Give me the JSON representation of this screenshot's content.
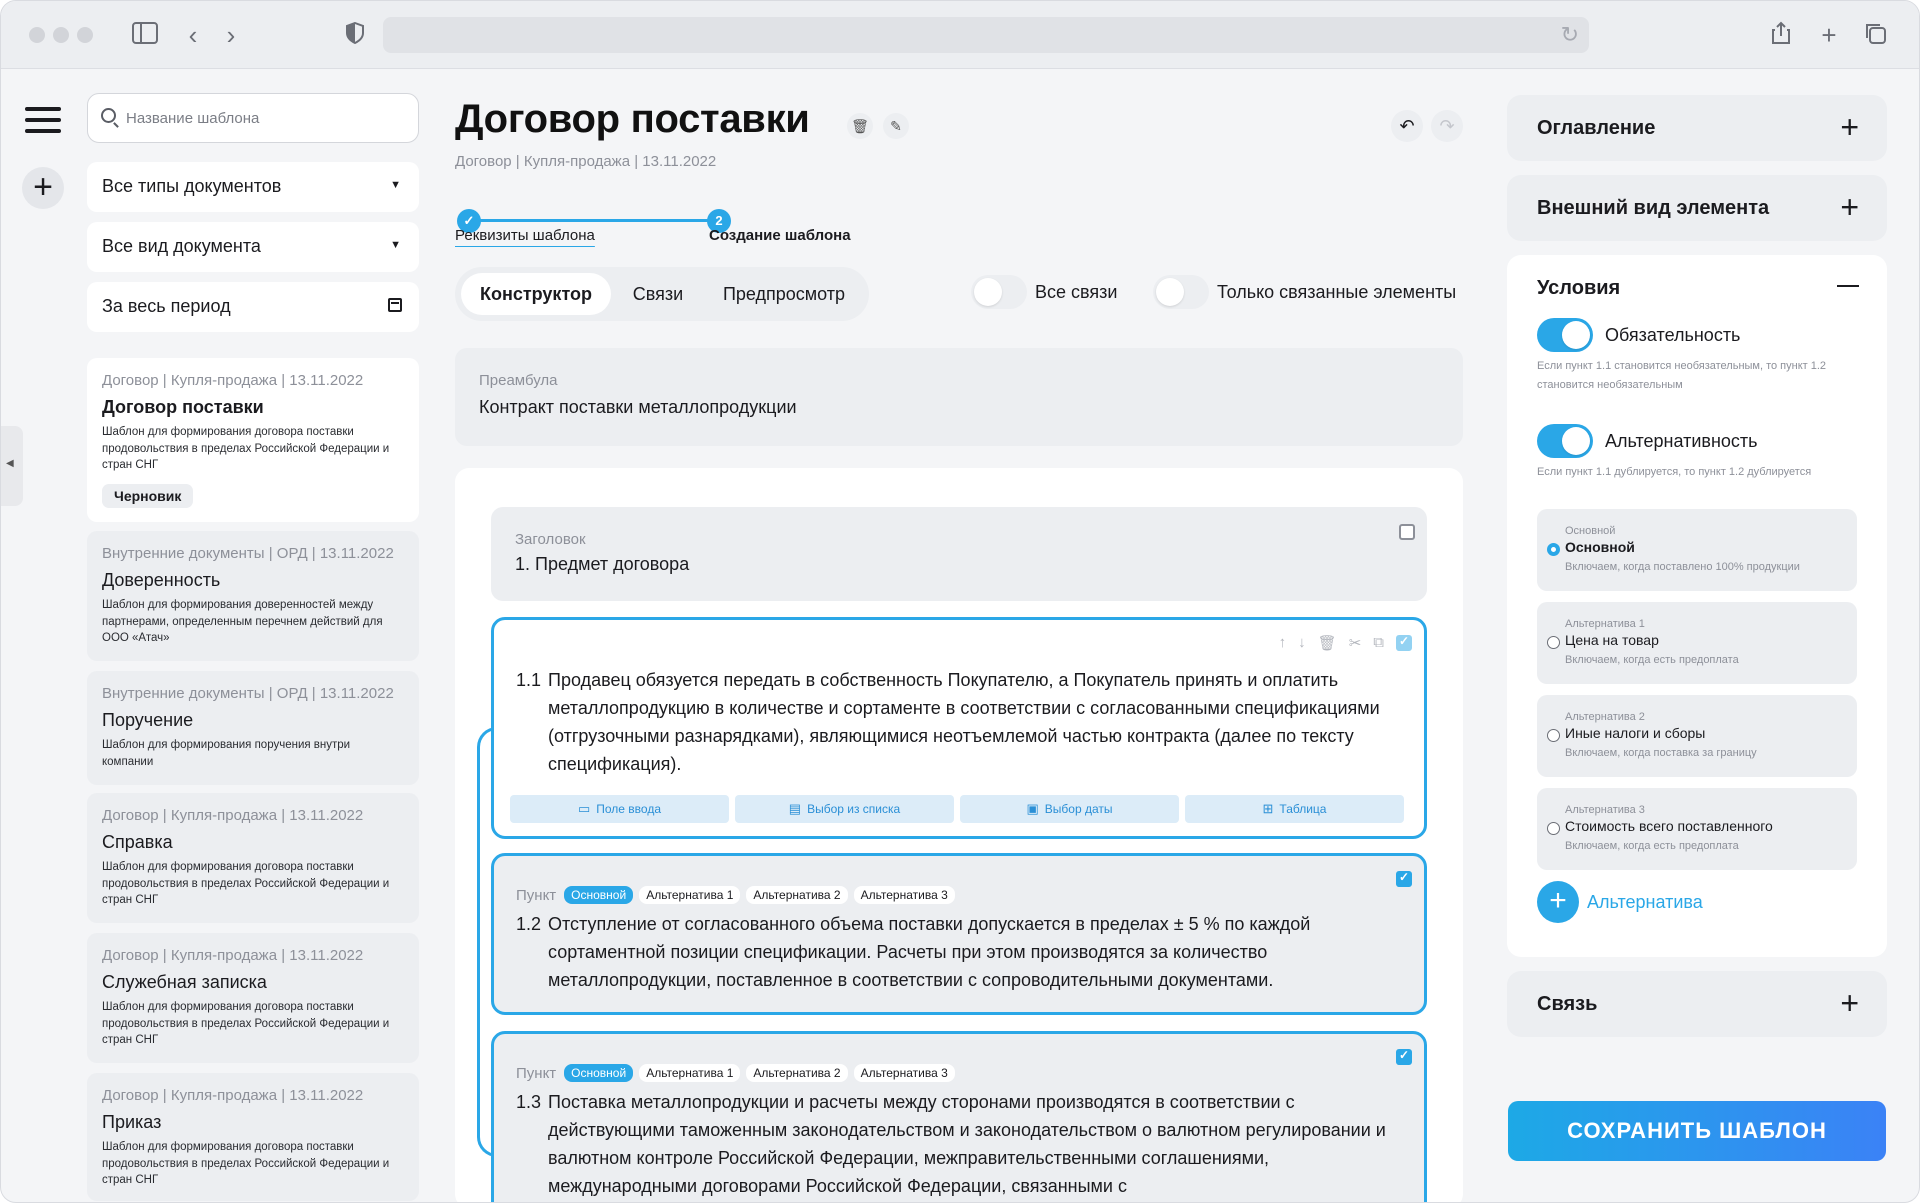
{
  "search": {
    "placeholder": "Название шаблона"
  },
  "filters": {
    "doc_types": "Все типы документов",
    "doc_kinds": "Все вид документа",
    "period": "За весь период"
  },
  "templates": [
    {
      "meta": "Договор | Купля-продажа | 13.11.2022",
      "title": "Договор поставки",
      "desc": "Шаблон для формирования договора поставки продовольствия в пределах Российской Федерации и стран СНГ",
      "badge": "Черновик"
    },
    {
      "meta": "Внутренние документы | ОРД | 13.11.2022",
      "title": "Доверенность",
      "desc": "Шаблон для формирования доверенностей между партнерами, определенным перечнем действий для ООО «Атач»"
    },
    {
      "meta": "Внутренние документы | ОРД | 13.11.2022",
      "title": "Поручение",
      "desc": "Шаблон для формирования поручения внутри компании"
    },
    {
      "meta": "Договор | Купля-продажа | 13.11.2022",
      "title": "Справка",
      "desc": "Шаблон для формирования договора поставки продовольствия в пределах Российской Федерации и стран СНГ"
    },
    {
      "meta": "Договор | Купля-продажа | 13.11.2022",
      "title": "Служебная записка",
      "desc": "Шаблон для формирования договора поставки продовольствия в пределах Российской Федерации и стран СНГ"
    },
    {
      "meta": "Договор | Купля-продажа | 13.11.2022",
      "title": "Приказ",
      "desc": "Шаблон для формирования договора поставки продовольствия в пределах Российской Федерации и стран СНГ"
    }
  ],
  "doc": {
    "title": "Договор поставки",
    "breadcrumb": "Договор | Купля-продажа | 13.11.2022"
  },
  "stepper": {
    "step1_label": "Реквизиты шаблона",
    "step2_num": "2",
    "step2_label": "Создание шаблона"
  },
  "tabs": [
    "Конструктор",
    "Связи",
    "Предпросмотр"
  ],
  "toggles": {
    "all_links": "Все связи",
    "only_linked": "Только связанные элементы"
  },
  "preamble": {
    "label": "Преамбула",
    "value": "Контракт поставки металлопродукции"
  },
  "heading_block": {
    "label": "Заголовок",
    "value": "1. Предмет договора"
  },
  "clauses": [
    {
      "num": "1.1",
      "text": "Продавец обязуется передать в собственность Покупателю, а Покупатель принять и оплатить металлопродукцию в количестве и сортаменте в соответствии с согласованными спецификациями (отгрузочными разнарядками), являющимися неотъемлемой частью контракта (далее по тексту спецификация)."
    },
    {
      "num": "1.2",
      "text": "Отступление от согласованного объема поставки допускается в пределах ± 5 % по каждой сортаментной позиции спецификации. Расчеты при этом производятся за количество металлопродукции, поставленное в соответствии с сопроводительными документами."
    },
    {
      "num": "1.3",
      "text": "Поставка металлопродукции и расчеты между сторонами производятся в соответствии с действующими таможенным законодательством и законодательством о валютном регулировании и валютном контроле Российской Федерации, межправительственными соглашениями, международными договорами Российской Федерации, связанными с"
    }
  ],
  "insert_buttons": [
    "Поле ввода",
    "Выбор из списка",
    "Выбор даты",
    "Таблица"
  ],
  "point_label": "Пункт",
  "point_chips": [
    "Основной",
    "Альтернатива 1",
    "Альтернатива 2",
    "Альтернатива 3"
  ],
  "right": {
    "toc": "Оглавление",
    "appearance": "Внешний вид элемента",
    "conditions": "Условия",
    "mandatory": "Обязательность",
    "mandatory_note": "Если пункт 1.1 становится необязательным, то пункт 1.2 становится необязательным",
    "alternativity": "Альтернативность",
    "alternativity_note": "Если пункт 1.1 дублируется, то пункт 1.2 дублируется",
    "alternatives": [
      {
        "kicker": "Основной",
        "name": "Основной",
        "desc": "Включаем, когда поставлено 100% продукции"
      },
      {
        "kicker": "Альтернатива 1",
        "name": "Цена на товар",
        "desc": "Включаем, когда есть предоплата"
      },
      {
        "kicker": "Альтернатива 2",
        "name": "Иные налоги и сборы",
        "desc": "Включаем, когда поставка за границу"
      },
      {
        "kicker": "Альтернатива 3",
        "name": "Стоимость всего поставленного",
        "desc": "Включаем, когда есть предоплата"
      }
    ],
    "add_alternative": "Альтернатива",
    "link": "Связь"
  },
  "save_button": "СОХРАНИТЬ ШАБЛОН",
  "colors": {
    "accent": "#2aa7e7",
    "accent_end": "#3b82f6",
    "panel": "#eceef1"
  }
}
